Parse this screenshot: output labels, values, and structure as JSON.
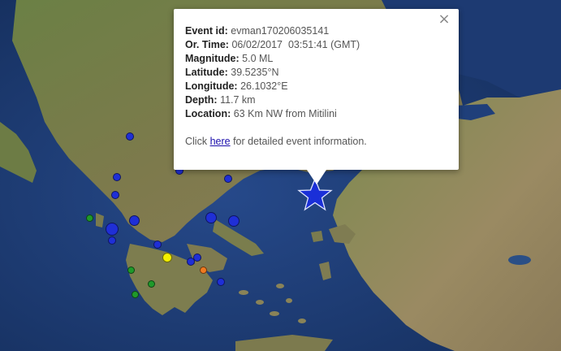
{
  "popup": {
    "close_glyph": "×",
    "fields": [
      {
        "label": "Event id:",
        "value": "evman170206035141"
      },
      {
        "label": "Or. Time:",
        "value": "06/02/2017  03:51:41 (GMT)"
      },
      {
        "label": "Magnitude:",
        "value": "5.0 ML"
      },
      {
        "label": "Latitude:",
        "value": "39.5235°N"
      },
      {
        "label": "Longitude:",
        "value": "26.1032°E"
      },
      {
        "label": "Depth:",
        "value": "11.7 km"
      },
      {
        "label": "Location:",
        "value": "63 Km NW from Mitilini"
      }
    ],
    "footer_prefix": "Click ",
    "footer_link": "here",
    "footer_suffix": " for detailed event information."
  },
  "colors": {
    "sea": "#1f3f7a",
    "land": "#5e7a3c",
    "marker_blue": "#1f2fd6",
    "marker_green": "#1f9a2a",
    "marker_yellow": "#f4f000",
    "marker_orange": "#f07a20",
    "star": "#1a2fd8"
  },
  "markers": {
    "icon_names": [
      "event-marker-blue",
      "event-marker-green",
      "event-marker-yellow",
      "event-marker-orange",
      "star-event-icon"
    ]
  }
}
